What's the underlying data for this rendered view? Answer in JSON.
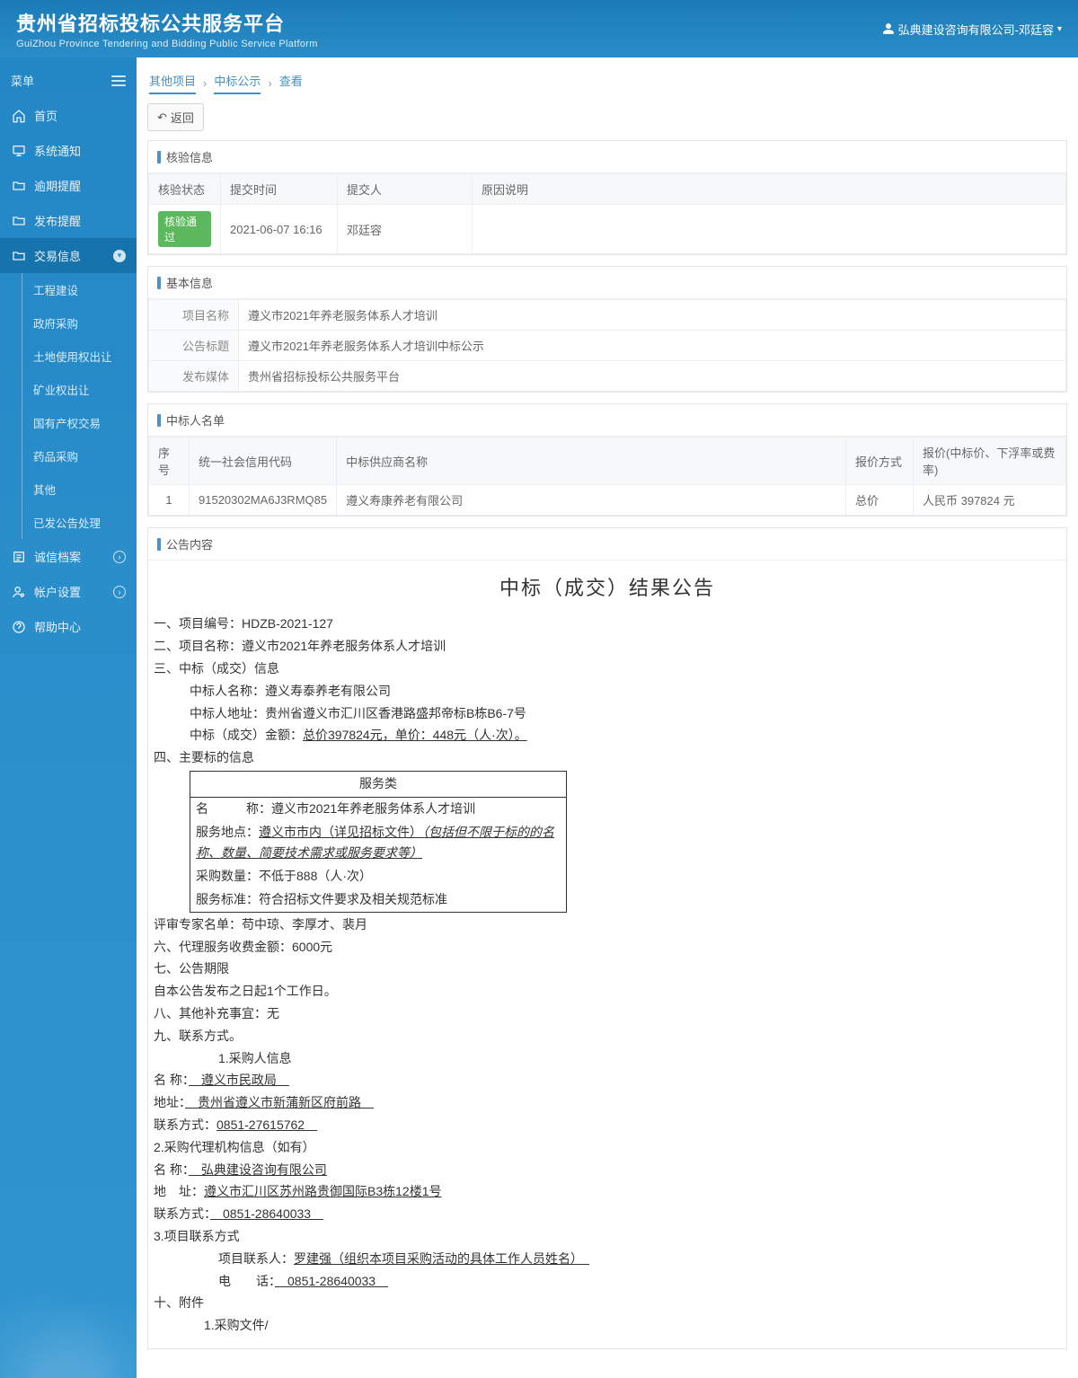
{
  "header": {
    "title": "贵州省招标投标公共服务平台",
    "subtitle": "GuiZhou Province Tendering and Bidding Public Service Platform",
    "user": "弘典建设咨询有限公司-邓廷容"
  },
  "sidebar": {
    "menu_label": "菜单",
    "items": [
      {
        "label": "首页"
      },
      {
        "label": "系统通知"
      },
      {
        "label": "逾期提醒"
      },
      {
        "label": "发布提醒"
      },
      {
        "label": "交易信息",
        "active": true
      },
      {
        "label": "诚信档案"
      },
      {
        "label": "帐户设置"
      },
      {
        "label": "帮助中心"
      }
    ],
    "sub_items": [
      {
        "label": "工程建设"
      },
      {
        "label": "政府采购"
      },
      {
        "label": "土地使用权出让"
      },
      {
        "label": "矿业权出让"
      },
      {
        "label": "国有产权交易"
      },
      {
        "label": "药品采购"
      },
      {
        "label": "其他"
      },
      {
        "label": "已发公告处理"
      }
    ]
  },
  "breadcrumb": {
    "a": "其他项目",
    "b": "中标公示",
    "c": "查看"
  },
  "back_btn": "返回",
  "panel_verify": {
    "title": "核验信息",
    "h_status": "核验状态",
    "h_time": "提交时间",
    "h_by": "提交人",
    "h_reason": "原因说明",
    "status": "核验通过",
    "time": "2021-06-07 16:16",
    "by": "邓廷容",
    "reason": ""
  },
  "panel_basic": {
    "title": "基本信息",
    "k1": "项目名称",
    "v1": "遵义市2021年养老服务体系人才培训",
    "k2": "公告标题",
    "v2": "遵义市2021年养老服务体系人才培训中标公示",
    "k3": "发布媒体",
    "v3": "贵州省招标投标公共服务平台"
  },
  "panel_bidders": {
    "title": "中标人名单",
    "h_no": "序号",
    "h_code": "统一社会信用代码",
    "h_name": "中标供应商名称",
    "h_mode": "报价方式",
    "h_price": "报价(中标价、下浮率或费率)",
    "rows": [
      {
        "no": "1",
        "code": "91520302MA6J3RMQ85",
        "name": "遵义寿康养老有限公司",
        "mode": "总价",
        "price": "人民币 397824 元"
      }
    ]
  },
  "panel_notice": {
    "title": "公告内容"
  },
  "notice": {
    "heading": "中标（成交）结果公告",
    "l1": "一、项目编号：HDZB-2021-127",
    "l2": "二、项目名称：遵义市2021年养老服务体系人才培训",
    "l3": "三、中标（成交）信息",
    "l3a": "中标人名称：遵义寿泰养老有限公司",
    "l3b": "中标人地址：贵州省遵义市汇川区香港路盛邦帝标B栋B6-7号",
    "l3c_t": "中标（成交）金额：",
    "l3c_u": "总价397824元，单价：448元（人·次）。",
    "l4": "四、主要标的信息",
    "svc_head": "服务类",
    "svc_a": "名　　　称：遵义市2021年养老服务体系人才培训",
    "svc_b1": "服务地点：",
    "svc_b2": "遵义市市内（详见招标文件）",
    "svc_b3": "（包括但不限于标的的名称、数量、简要技术需求或服务要求等）",
    "svc_c": "采购数量：不低于888（人·次）",
    "svc_d": "服务标准：符合招标文件要求及相关规范标准",
    "l5": "评审专家名单：苟中琼、李厚才、裴月",
    "l6": "六、代理服务收费金额：6000元",
    "l7": "七、公告期限",
    "l7a": "自本公告发布之日起1个工作日。",
    "l8": "八、其他补充事宜：无",
    "l9": "九、联系方式。",
    "l9a": "1.采购人信息",
    "l9b_t": "名  称：",
    "l9b_u": "　遵义市民政局　",
    "l9c_t": "地址：",
    "l9c_u": "　贵州省遵义市新蒲新区府前路　",
    "l9d_t": "联系方式：",
    "l9d_u": "0851-27615762　",
    "l9e": "2.采购代理机构信息（如有）",
    "l9f_t": "名  称：",
    "l9f_u": "　弘典建设咨询有限公司",
    "l9g_t": "地　址：",
    "l9g_u": "遵义市汇川区苏州路贵御国际B3栋12楼1号",
    "l9h_t": "联系方式：",
    "l9h_u": "　0851-28640033　",
    "l9i": "3.项目联系方式",
    "l9j_t": "项目联系人：",
    "l9j_u": "罗建强（组织本项目采购活动的具体工作人员姓名）　",
    "l9k_t": "电　　话：",
    "l9k_u": "　0851-28640033　",
    "l10": "十、附件",
    "l10a": "1.采购文件/"
  }
}
